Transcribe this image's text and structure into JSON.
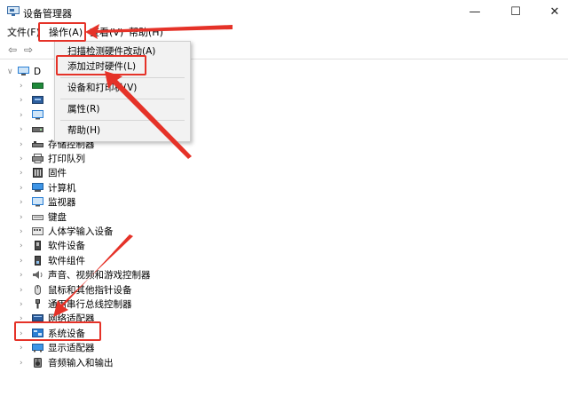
{
  "window": {
    "title": "设备管理器",
    "minimize_glyph": "—",
    "maximize_glyph": "☐",
    "close_glyph": "✕"
  },
  "menubar": {
    "file": "文件(F)",
    "action": "操作(A)",
    "view": "查看(V)",
    "help": "帮助(H)"
  },
  "toolbar": {
    "back_glyph": "⇦",
    "forward_glyph": "⇨"
  },
  "tree": {
    "root": {
      "chevron": "∨",
      "label": "D"
    },
    "chevron": "›",
    "items": [
      {
        "label": "",
        "icon": "ide-icon"
      },
      {
        "label": "",
        "icon": "network-icon"
      },
      {
        "label": "",
        "icon": "monitor-icon"
      },
      {
        "label": "",
        "icon": "disk-icon"
      },
      {
        "label": "存储控制器",
        "icon": "storage-controller-icon"
      },
      {
        "label": "打印队列",
        "icon": "print-queue-icon"
      },
      {
        "label": "固件",
        "icon": "firmware-icon"
      },
      {
        "label": "计算机",
        "icon": "computer-icon"
      },
      {
        "label": "监视器",
        "icon": "monitor-icon"
      },
      {
        "label": "键盘",
        "icon": "keyboard-icon"
      },
      {
        "label": "人体学输入设备",
        "icon": "hid-icon"
      },
      {
        "label": "软件设备",
        "icon": "software-device-icon"
      },
      {
        "label": "软件组件",
        "icon": "software-component-icon"
      },
      {
        "label": "声音、视频和游戏控制器",
        "icon": "sound-icon"
      },
      {
        "label": "鼠标和其他指针设备",
        "icon": "mouse-icon"
      },
      {
        "label": "通用串行总线控制器",
        "icon": "usb-icon"
      },
      {
        "label": "网络适配器",
        "icon": "network-adapter-icon"
      },
      {
        "label": "系统设备",
        "icon": "system-device-icon"
      },
      {
        "label": "显示适配器",
        "icon": "display-adapter-icon"
      },
      {
        "label": "音频输入和输出",
        "icon": "audio-io-icon"
      }
    ]
  },
  "context_menu": {
    "scan": "扫描检测硬件改动(A)",
    "add_legacy": "添加过时硬件(L)",
    "devices_printers": "设备和打印机(V)",
    "properties": "属性(R)",
    "help": "帮助(H)"
  },
  "colors": {
    "highlight": "#e53228",
    "icon_blue": "#2a7fd4",
    "icon_dark": "#3c3c3c"
  }
}
